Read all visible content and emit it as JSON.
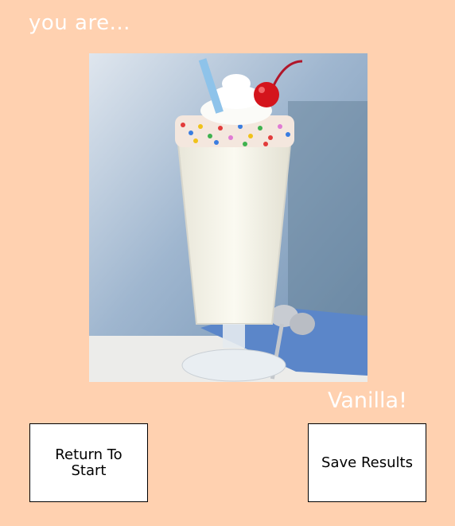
{
  "heading": "you are...",
  "result": {
    "flavor": "Vanilla!"
  },
  "image": {
    "subject": "vanilla-milkshake-photo"
  },
  "buttons": {
    "return_label": "Return To\nStart",
    "save_label": "Save Results"
  },
  "colors": {
    "background": "#FFD1B0",
    "text": "#FFFFFF",
    "button_bg": "#FFFFFF",
    "button_border": "#000000"
  }
}
